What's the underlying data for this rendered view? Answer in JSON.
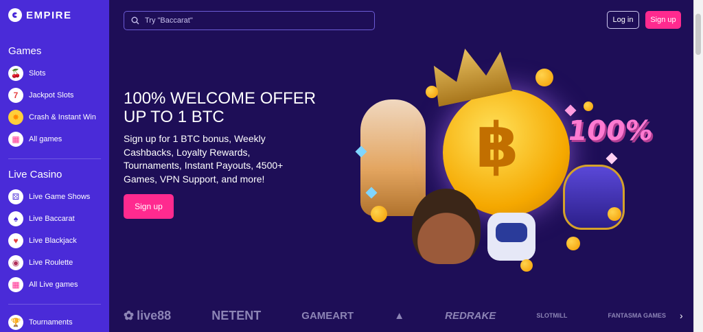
{
  "logo": {
    "text": "EMPIRE"
  },
  "sidebar": {
    "sections": [
      {
        "title": "Games",
        "items": [
          {
            "label": "Slots",
            "icon": "cherries-icon"
          },
          {
            "label": "Jackpot Slots",
            "icon": "seven-icon"
          },
          {
            "label": "Crash & Instant Win",
            "icon": "sun-icon"
          },
          {
            "label": "All games",
            "icon": "grid-icon"
          }
        ]
      },
      {
        "title": "Live Casino",
        "items": [
          {
            "label": "Live Game Shows",
            "icon": "dice-icon"
          },
          {
            "label": "Live Baccarat",
            "icon": "cards-icon"
          },
          {
            "label": "Live Blackjack",
            "icon": "card-icon"
          },
          {
            "label": "Live Roulette",
            "icon": "roulette-icon"
          },
          {
            "label": "All Live games",
            "icon": "grid-icon"
          }
        ]
      },
      {
        "title": "",
        "items": [
          {
            "label": "Tournaments",
            "icon": "trophy-icon"
          }
        ]
      }
    ]
  },
  "header": {
    "search_placeholder": "Try \"Baccarat\"",
    "login_label": "Log in",
    "signup_label": "Sign up"
  },
  "hero": {
    "title": "100% WELCOME OFFER UP TO 1 BTC",
    "description": "Sign up for 1 BTC bonus, Weekly Cashbacks, Loyalty Rewards, Tournaments, Instant Payouts, 4500+ Games, VPN Support, and more!",
    "cta_label": "Sign up",
    "art_badge": "100%",
    "coin_symbol": "฿"
  },
  "providers": [
    "live88",
    "NETENT",
    "GAMEART",
    "",
    "REDRAKE",
    "SLOTMILL",
    "FANTASMA GAMES"
  ],
  "colors": {
    "sidebar": "#4a2bd8",
    "background": "#1e0e57",
    "accent": "#ff2a8f"
  }
}
